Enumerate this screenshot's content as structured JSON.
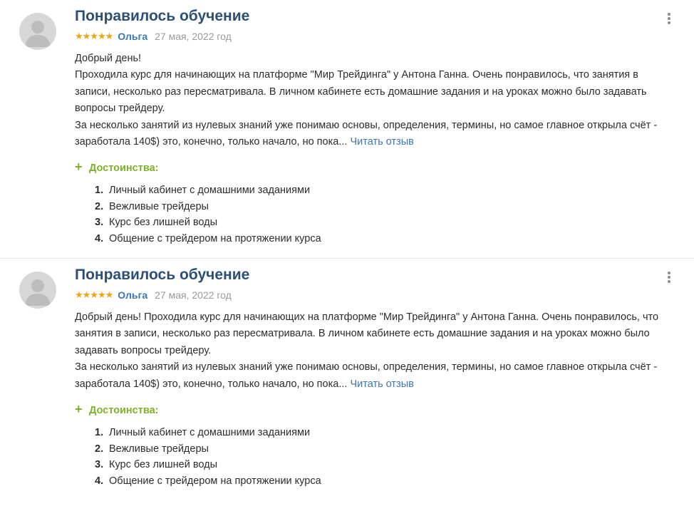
{
  "reviews": [
    {
      "title": "Понравилось обучение",
      "stars": "★★★★★",
      "author": "Ольга",
      "date": "27 мая, 2022 год",
      "paragraphs": [
        "Добрый день!",
        "Проходила курс для начинающих на платформе \"Мир Трейдинга\" у Антона Ганна. Очень понравилось, что занятия в записи, несколько раз пересматривала. В личном кабинете есть домашние задания и на уроках можно было задавать вопросы трейдеру.",
        "За несколько занятий из нулевых знаний уже понимаю основы, определения, термины, но самое главное открыла счёт - заработала 140$) это, конечно, только начало, но пока..."
      ],
      "read_more": "Читать отзыв",
      "pros_title": "Достоинства:",
      "pros": [
        {
          "num": "1.",
          "text": "Личный кабинет с домашними заданиями"
        },
        {
          "num": "2.",
          "text": "Вежливые трейдеры"
        },
        {
          "num": "3.",
          "text": "Курс без лишней воды"
        },
        {
          "num": "4.",
          "text": "Общение с трейдером на протяжении курса"
        }
      ]
    },
    {
      "title": "Понравилось обучение",
      "stars": "★★★★★",
      "author": "Ольга",
      "date": "27 мая, 2022 год",
      "paragraphs": [
        "Добрый день! Проходила курс для начинающих на платформе \"Мир Трейдинга\" у Антона Ганна. Очень понравилось, что занятия в записи, несколько раз пересматривала. В личном кабинете есть домашние задания и на уроках можно было задавать вопросы трейдеру.",
        "За несколько занятий из нулевых знаний уже понимаю основы, определения, термины, но самое главное открыла счёт - заработала 140$) это, конечно, только начало, но пока..."
      ],
      "read_more": "Читать отзыв",
      "pros_title": "Достоинства:",
      "pros": [
        {
          "num": "1.",
          "text": "Личный кабинет с домашними заданиями"
        },
        {
          "num": "2.",
          "text": "Вежливые трейдеры"
        },
        {
          "num": "3.",
          "text": "Курс без лишней воды"
        },
        {
          "num": "4.",
          "text": "Общение с трейдером на протяжении курса"
        }
      ]
    }
  ],
  "icons": {
    "avatar": "user-avatar-icon",
    "more": "more-vertical-icon",
    "plus": "plus-icon"
  },
  "colors": {
    "title": "#2c4f78",
    "link": "#3a77b6",
    "stars": "#f2a311",
    "pros": "#7db128",
    "date": "#9a9a9a"
  }
}
